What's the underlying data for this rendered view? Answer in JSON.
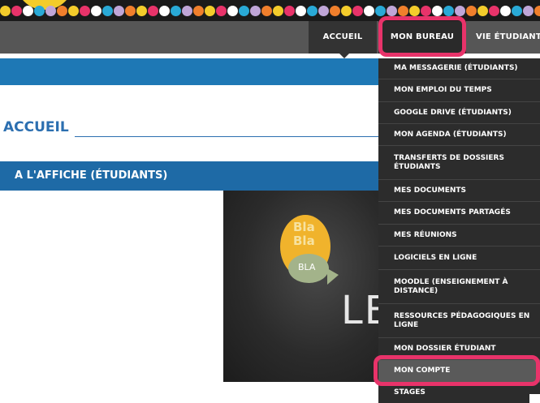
{
  "nav": {
    "accueil": "ACCUEIL",
    "mon_bureau": "MON BUREAU",
    "vie_etudiante": "VIE ÉTUDIANTE"
  },
  "page": {
    "title": "ACCUEIL",
    "section": "A L'AFFICHE (ÉTUDIANTS)"
  },
  "poster": {
    "bubble_line1": "Bla",
    "bubble_line2": "Bla",
    "bubble_line3": "BLA",
    "word": "LE"
  },
  "dropdown": {
    "items": [
      {
        "label": "MA MESSAGERIE (ÉTUDIANTS)"
      },
      {
        "label": "MON EMPLOI DU TEMPS"
      },
      {
        "label": "GOOGLE DRIVE (ÉTUDIANTS)"
      },
      {
        "label": "MON AGENDA (ÉTUDIANTS)"
      },
      {
        "label": "TRANSFERTS DE DOSSIERS ÉTUDIANTS"
      },
      {
        "label": "MES DOCUMENTS"
      },
      {
        "label": "MES DOCUMENTS PARTAGÉS"
      },
      {
        "label": "MES RÉUNIONS"
      },
      {
        "label": "LOGICIELS EN LIGNE"
      },
      {
        "label": "MOODLE (ENSEIGNEMENT À DISTANCE)"
      },
      {
        "label": "RESSOURCES PÉDAGOGIQUES EN LIGNE"
      },
      {
        "label": "MON DOSSIER ÉTUDIANT"
      },
      {
        "label": "MON COMPTE"
      },
      {
        "label": "STAGES"
      }
    ],
    "highlighted_item": "MON COMPTE"
  },
  "colors": {
    "highlight": "#e8336a",
    "primary_blue": "#1e78b5",
    "nav_dark": "#565656"
  },
  "icons": {
    "nav_caret": "caret-down-icon"
  }
}
